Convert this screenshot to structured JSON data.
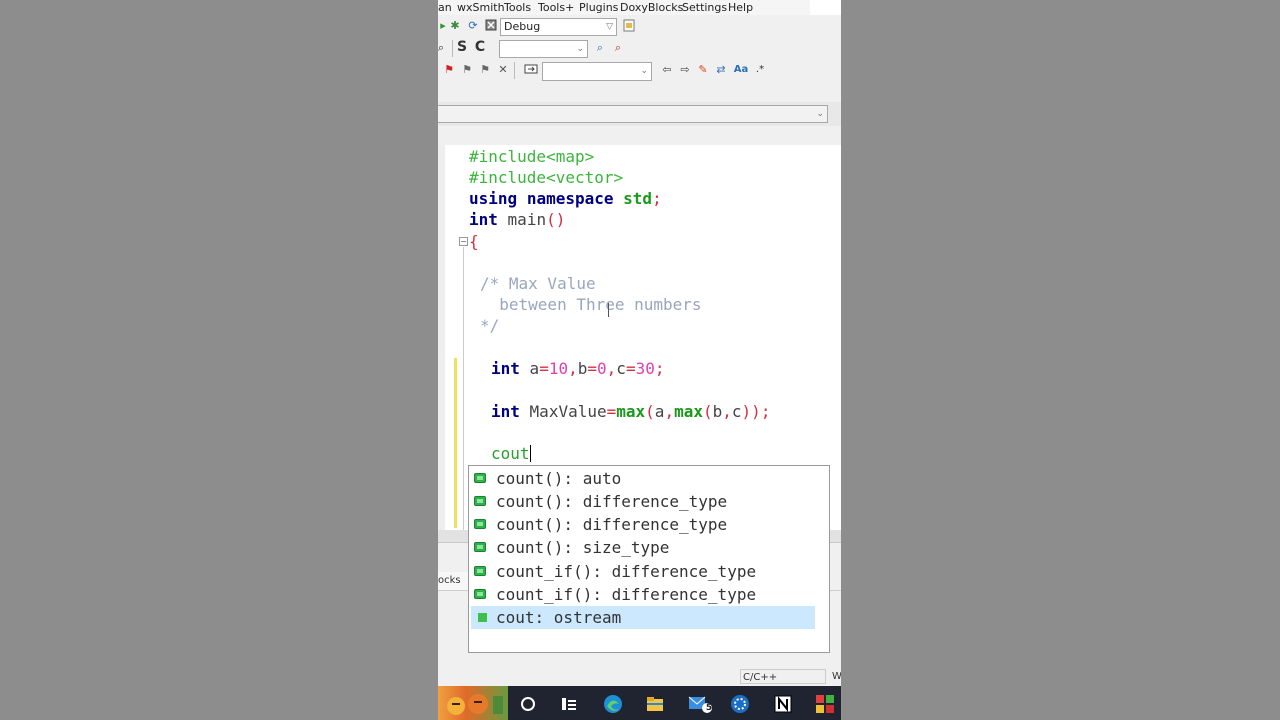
{
  "menu": [
    "an",
    "wxSmith",
    "Tools",
    "Tools+",
    "Plugins",
    "DoxyBlocks",
    "Settings",
    "Help"
  ],
  "toolbar": {
    "build_target": "Debug",
    "search_letters": [
      "S",
      "C"
    ],
    "search_combo": "",
    "jump_combo": "",
    "scope_combo": ""
  },
  "code_lines": {
    "l1": "#include<map>",
    "l2": "#include<vector>",
    "l3_kw1": "using",
    "l3_kw2": "namespace",
    "l3_std": "std",
    "l3_semi": ";",
    "l4_kw": "int",
    "l4_name": "main",
    "l4_par": "()",
    "l5": "{",
    "c1": "/* Max Value",
    "c2": "  between Three numbers",
    "c3": "*/",
    "d_kw": "int",
    "d_a": "a",
    "d_eq1": "=",
    "d_10": "10",
    "d_c1": ",",
    "d_b": "b",
    "d_eq2": "=",
    "d_0": "0",
    "d_c2": ",",
    "d_c": "c",
    "d_eq3": "=",
    "d_30": "30",
    "d_semi": ";",
    "m_kw": "int",
    "m_name": "MaxValue",
    "m_eq": "=",
    "m_max1": "max",
    "m_p1": "(",
    "m_a": "a",
    "m_comma": ",",
    "m_max2": "max",
    "m_p2": "(",
    "m_b": "b",
    "m_comma2": ",",
    "m_c": "c",
    "m_close": "));",
    "cout": "cout"
  },
  "autocomplete": {
    "items": [
      {
        "label": "count(): auto",
        "kind": "function"
      },
      {
        "label": "count(): difference_type",
        "kind": "function"
      },
      {
        "label": "count(): difference_type",
        "kind": "function"
      },
      {
        "label": "count(): size_type",
        "kind": "function"
      },
      {
        "label": "count_if(): difference_type",
        "kind": "function"
      },
      {
        "label": "count_if(): difference_type",
        "kind": "function"
      },
      {
        "label": "cout: ostream",
        "kind": "variable",
        "selected": true
      }
    ]
  },
  "bottom_panel": {
    "tab_label": "ocks"
  },
  "status": {
    "language": "C/C++",
    "edge": "W"
  },
  "taskbar": {
    "notification_count": "5"
  },
  "colors": {
    "selection": "#cce8ff",
    "preprocessor": "#3cb53c",
    "keyword": "#000080",
    "comment": "#9aa6bd",
    "number": "#e040b0"
  }
}
